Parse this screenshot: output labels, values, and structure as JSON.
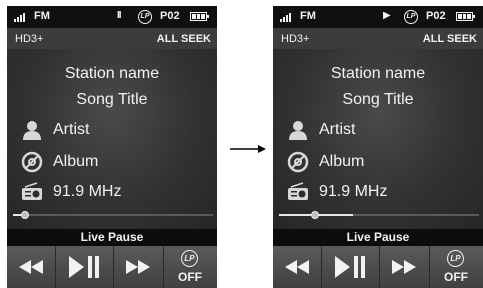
{
  "screens": [
    {
      "status": {
        "band": "FM",
        "play_state_glyph": "II",
        "lp_badge": "LP",
        "preset": "P02"
      },
      "mode": {
        "left": "HD3+",
        "right": "ALL SEEK"
      },
      "info": {
        "station": "Station name",
        "song": "Song Title",
        "artist": "Artist",
        "album": "Album",
        "frequency": "91.9 MHz"
      },
      "progress": {
        "fraction": 0.06,
        "knob_fraction": 0.06
      },
      "live_label": "Live Pause",
      "controls": {
        "lp_label": "LP",
        "lp_state": "OFF"
      }
    },
    {
      "status": {
        "band": "FM",
        "play_state_glyph": "▶",
        "lp_badge": "LP",
        "preset": "P02"
      },
      "mode": {
        "left": "HD3+",
        "right": "ALL SEEK"
      },
      "info": {
        "station": "Station name",
        "song": "Song Title",
        "artist": "Artist",
        "album": "Album",
        "frequency": "91.9 MHz"
      },
      "progress": {
        "fraction": 0.37,
        "knob_fraction": 0.18
      },
      "live_label": "Live Pause",
      "controls": {
        "lp_label": "LP",
        "lp_state": "OFF"
      }
    }
  ],
  "icons": {
    "signal": "signal-bars-icon",
    "battery": "battery-icon",
    "artist": "person-icon",
    "album": "disc-icon",
    "frequency": "radio-icon",
    "rewind": "rewind-icon",
    "play_pause": "play-pause-icon",
    "fast_forward": "fast-forward-icon",
    "arrow": "right-arrow-icon"
  },
  "colors": {
    "screen_bg": "#2b2b2b",
    "bar_bg": "#101010",
    "text": "#f2f2f2"
  }
}
